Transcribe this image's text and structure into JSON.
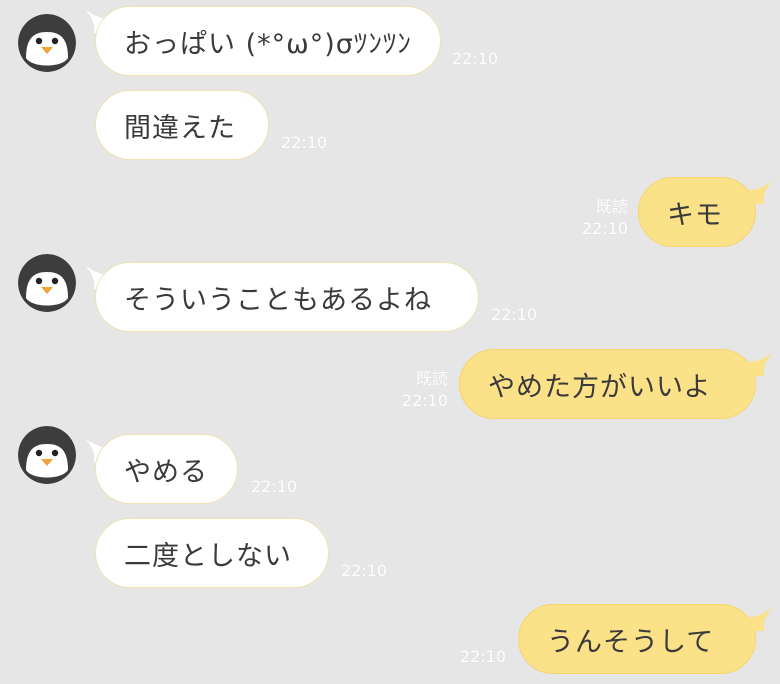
{
  "avatar_icon": "penguin-icon",
  "colors": {
    "background": "#e6e6e6",
    "incoming_bubble": "#ffffff",
    "outgoing_bubble": "#fbe188"
  },
  "messages": [
    {
      "side": "in",
      "text": "おっぱい (*°ω°)σﾂﾝﾂﾝ",
      "time": "22:10"
    },
    {
      "side": "in",
      "text": "間違えた",
      "time": "22:10"
    },
    {
      "side": "out",
      "text": "キモ",
      "read": "既読",
      "time": "22:10"
    },
    {
      "side": "in",
      "text": "そういうこともあるよね",
      "time": "22:10"
    },
    {
      "side": "out",
      "text": "やめた方がいいよ",
      "read": "既読",
      "time": "22:10"
    },
    {
      "side": "in",
      "text": "やめる",
      "time": "22:10"
    },
    {
      "side": "in",
      "text": "二度としない",
      "time": "22:10"
    },
    {
      "side": "out",
      "text": "うんそうして",
      "time": "22:10"
    }
  ]
}
